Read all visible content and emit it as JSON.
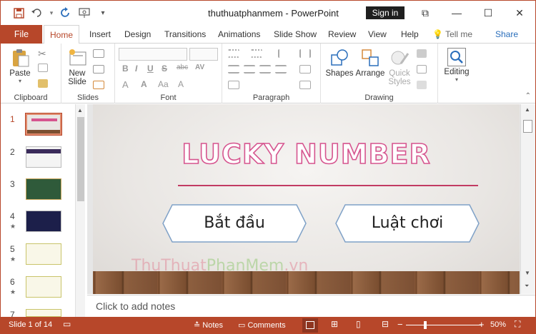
{
  "window": {
    "title": "thuthuatphanmem  -  PowerPoint",
    "sign_in": "Sign in",
    "restore": "⧉",
    "minimize": "—",
    "maximize": "☐",
    "close": "✕"
  },
  "qat": {
    "save_icon": "save-icon",
    "undo_icon": "undo-icon",
    "redo_icon": "redo-icon",
    "present_icon": "present-icon",
    "more": "▾"
  },
  "tabs": {
    "file": "File",
    "items": [
      "Home",
      "Insert",
      "Design",
      "Transitions",
      "Animations",
      "Slide Show",
      "Review",
      "View",
      "Help"
    ],
    "tell_me": "Tell me",
    "share": "Share"
  },
  "ribbon": {
    "clipboard": {
      "label": "Clipboard",
      "paste": "Paste"
    },
    "slides": {
      "label": "Slides",
      "new_slide": "New",
      "new_slide2": "Slide"
    },
    "font": {
      "label": "Font",
      "bold": "B",
      "italic": "I",
      "underline": "U",
      "strike": "S",
      "shadow": "abc",
      "spacing": "AV",
      "grow": "A",
      "shrink": "A",
      "case": "Aa",
      "clear": "A"
    },
    "paragraph": {
      "label": "Paragraph"
    },
    "drawing": {
      "label": "Drawing",
      "shapes": "Shapes",
      "arrange": "Arrange",
      "quick_styles": "Quick",
      "quick_styles2": "Styles"
    },
    "editing": {
      "label": "Editing"
    }
  },
  "thumbnails": [
    {
      "num": "1",
      "star": ""
    },
    {
      "num": "2",
      "star": ""
    },
    {
      "num": "3",
      "star": ""
    },
    {
      "num": "4",
      "star": "★"
    },
    {
      "num": "5",
      "star": "★"
    },
    {
      "num": "6",
      "star": "★"
    },
    {
      "num": "7",
      "star": ""
    }
  ],
  "slide": {
    "title": "LUCKY NUMBER",
    "button1": "Bắt đầu",
    "button2": "Luật chơi",
    "watermark1": "ThuThuat",
    "watermark2": "PhanMem",
    "watermark3": ".vn"
  },
  "notes": {
    "placeholder": "Click to add notes"
  },
  "status": {
    "slide_info": "Slide 1 of 14",
    "notes": "Notes",
    "comments": "Comments",
    "zoom_minus": "−",
    "zoom_plus": "+",
    "zoom": "50%"
  },
  "colors": {
    "accent": "#b7472a",
    "title_outline": "#d6558f",
    "divider": "#c23b63"
  }
}
